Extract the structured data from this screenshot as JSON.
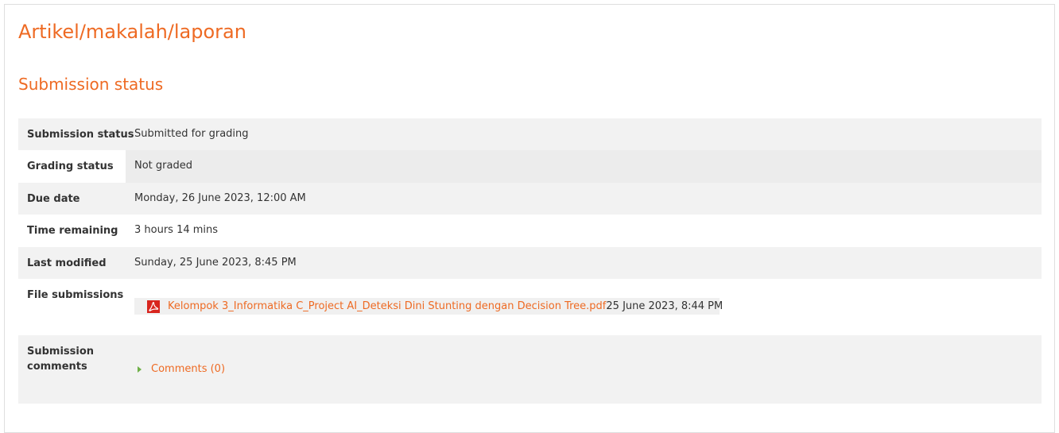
{
  "page": {
    "title": "Artikel/makalah/laporan",
    "section_title": "Submission status"
  },
  "status": {
    "rows": [
      {
        "label": "Submission status",
        "value": "Submitted for grading"
      },
      {
        "label": "Grading status",
        "value": "Not graded"
      },
      {
        "label": "Due date",
        "value": "Monday, 26 June 2023, 12:00 AM"
      },
      {
        "label": "Time remaining",
        "value": "3 hours 14 mins"
      },
      {
        "label": "Last modified",
        "value": "Sunday, 25 June 2023, 8:45 PM"
      }
    ],
    "file_submissions": {
      "label": "File submissions",
      "file_name": "Kelompok 3_Informatika C_Project AI_Deteksi Dini Stunting dengan Decision Tree.pdf",
      "file_date": "25 June 2023, 8:44 PM",
      "icon": "pdf-icon"
    },
    "submission_comments": {
      "label_line1": "Submission",
      "label_line2": "comments",
      "toggle_label": "Comments (0)",
      "icon": "triangle-right-icon"
    }
  },
  "colors": {
    "accent": "#ee6a23",
    "row_shade": "#f2f2f2",
    "toggle_green": "#6fb048",
    "pdf_red": "#d8251e"
  }
}
